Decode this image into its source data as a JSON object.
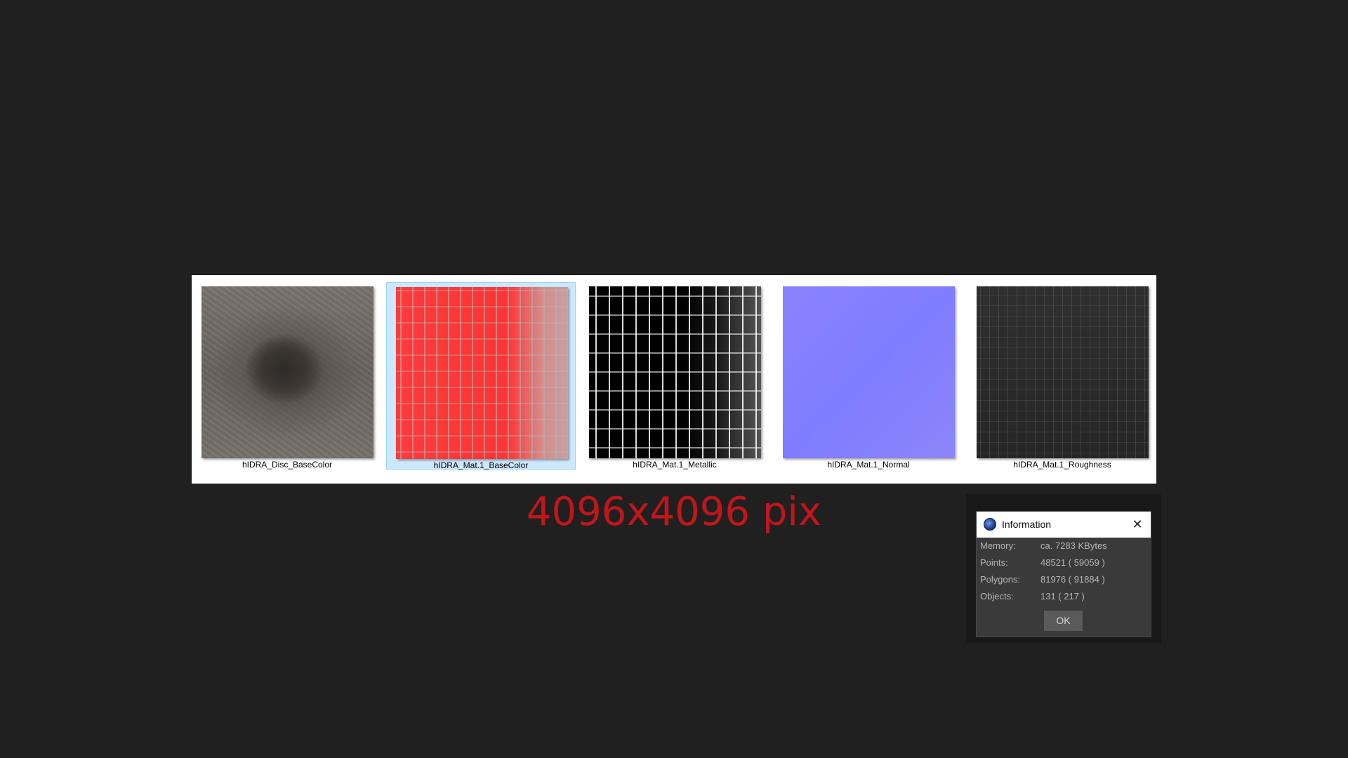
{
  "thumbnails": [
    {
      "label": "hIDRA_Disc_BaseColor",
      "texture": "disc-basecolor",
      "selected": false
    },
    {
      "label": "hIDRA_Mat.1_BaseColor",
      "texture": "mat-basecolor",
      "selected": true
    },
    {
      "label": "hIDRA_Mat.1_Metallic",
      "texture": "mat-metallic",
      "selected": false
    },
    {
      "label": "hIDRA_Mat.1_Normal",
      "texture": "mat-normal",
      "selected": false
    },
    {
      "label": "hIDRA_Mat.1_Roughness",
      "texture": "mat-roughness",
      "selected": false
    }
  ],
  "caption": {
    "text": "4096x4096 pix",
    "color": "#c0161b"
  },
  "info_dialog": {
    "title": "Information",
    "icon": "cinema4d-logo-icon",
    "close_icon": "close-icon",
    "rows": [
      {
        "key": "Memory:",
        "value": "ca. 7283 KBytes"
      },
      {
        "key": "Points:",
        "value": "48521 ( 59059 )"
      },
      {
        "key": "Polygons:",
        "value": "81976 ( 91884 )"
      },
      {
        "key": "Objects:",
        "value": "131 ( 217 )"
      }
    ],
    "ok_label": "OK"
  },
  "colors": {
    "background": "#202020",
    "selection_fill": "#cce8ff",
    "selection_border": "#99d1ff",
    "dialog_body": "#3a3a3a"
  }
}
